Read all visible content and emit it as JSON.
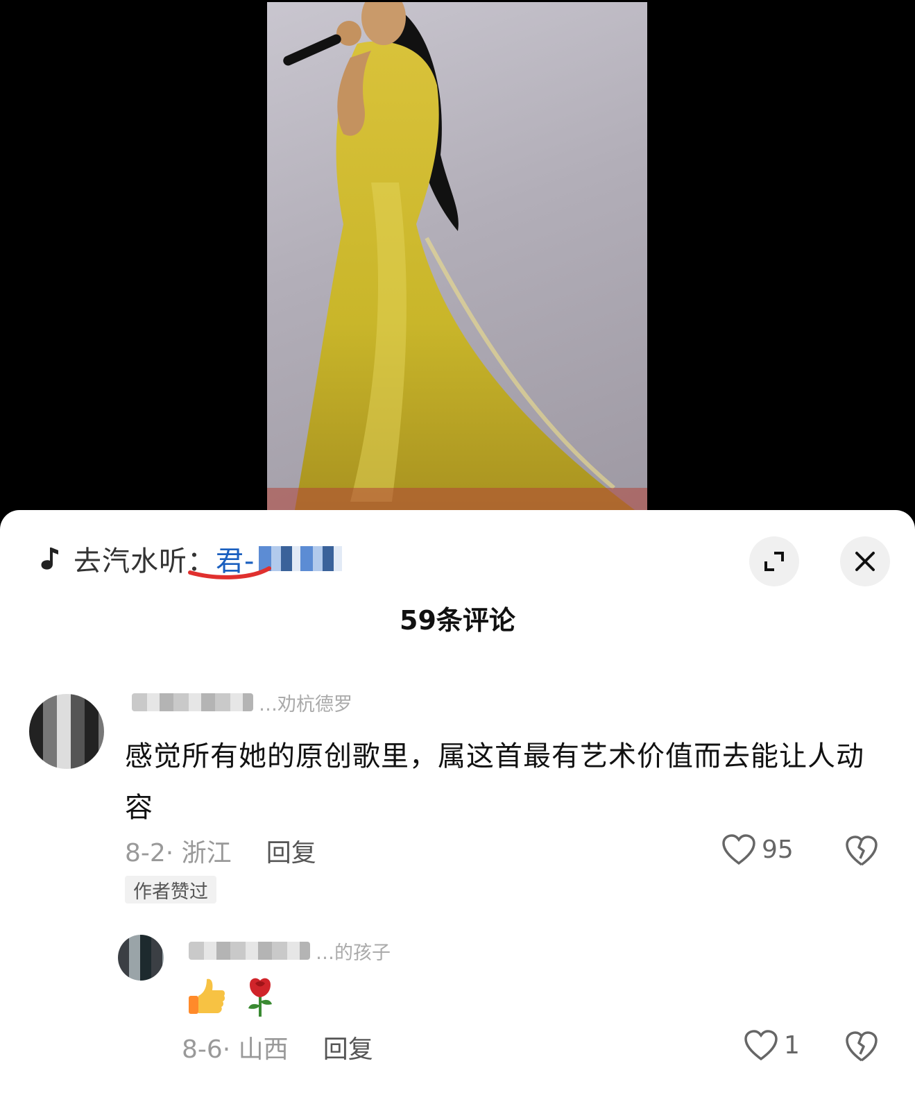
{
  "music_bar": {
    "prefix": "去汽水听：",
    "song": "君-"
  },
  "comments_title": "59条评论",
  "comments": [
    {
      "username_visible": "…劝杭德罗",
      "text": "感觉所有她的原创歌里，属这首最有艺术价值而去能让人动容",
      "date_loc": "8-2· 浙江",
      "reply": "回复",
      "likes": "95",
      "badge": "作者赞过"
    }
  ],
  "reply_comment": {
    "username_visible": "…的孩子",
    "emojis": [
      "thumbs-up",
      "rose"
    ],
    "date_loc": "8-6· 山西",
    "reply": "回复",
    "likes": "1"
  },
  "colors": {
    "song_link": "#1a5fbf",
    "underline": "#e0302e",
    "dress": "#c9b62a"
  }
}
